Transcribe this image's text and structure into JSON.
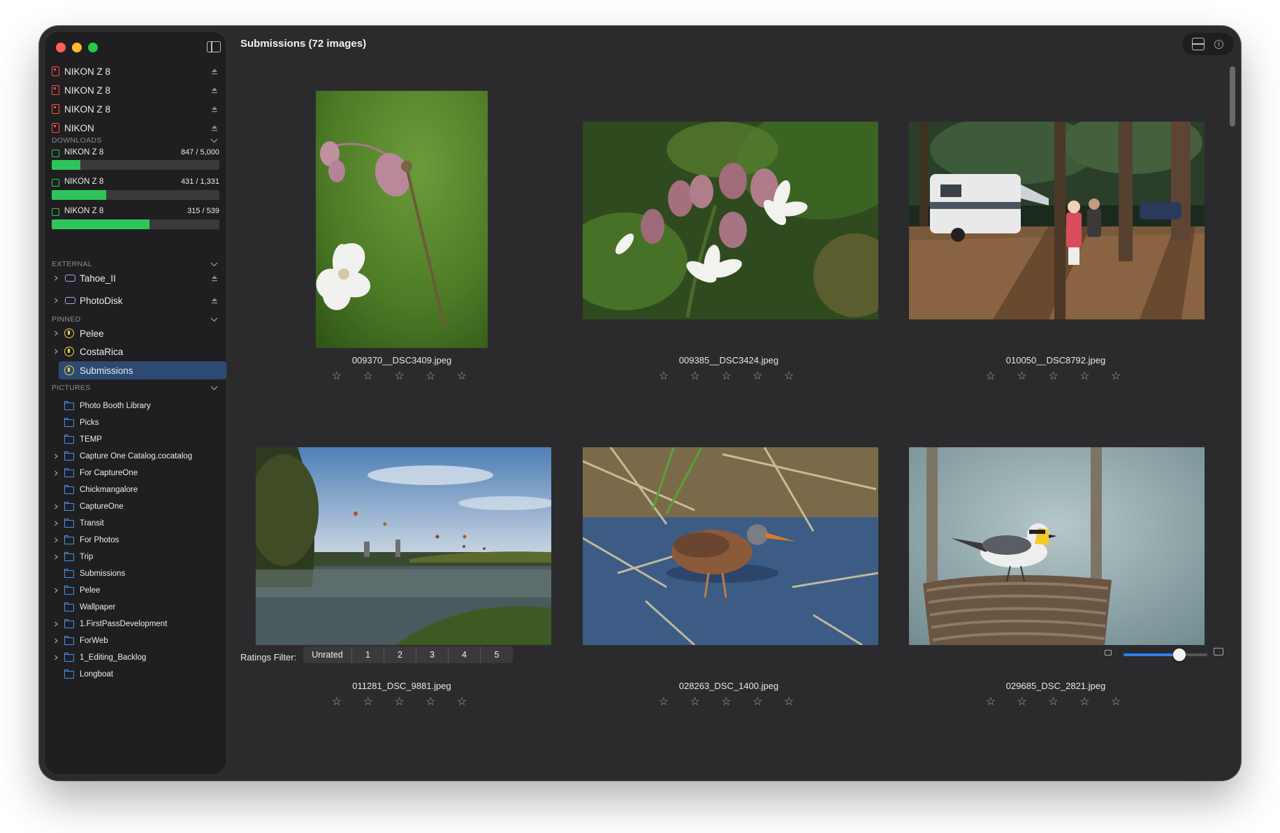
{
  "window": {
    "title": "Submissions (72 images)"
  },
  "sidebar": {
    "devices": [
      {
        "label": "NIKON Z 8",
        "icon": "camera-card-icon"
      },
      {
        "label": "NIKON Z 8",
        "icon": "camera-card-icon"
      },
      {
        "label": "NIKON Z 8",
        "icon": "camera-card-icon"
      },
      {
        "label": "NIKON",
        "icon": "camera-card-icon"
      }
    ],
    "downloads": {
      "header": "DOWNLOADS",
      "items": [
        {
          "label": "NIKON Z 8",
          "count": "847 / 5,000",
          "progress": 0.169
        },
        {
          "label": "NIKON Z 8",
          "count": "431 / 1,331",
          "progress": 0.324
        },
        {
          "label": "NIKON Z 8",
          "count": "315 / 539",
          "progress": 0.584
        }
      ]
    },
    "external": {
      "header": "EXTERNAL",
      "items": [
        {
          "label": "Tahoe_II"
        },
        {
          "label": "PhotoDisk"
        }
      ]
    },
    "pinned": {
      "header": "PINNED",
      "items": [
        {
          "label": "Pelee",
          "expandable": true
        },
        {
          "label": "CostaRica",
          "expandable": true
        },
        {
          "label": "Submissions",
          "expandable": false,
          "selected": true
        }
      ]
    },
    "pictures": {
      "header": "PICTURES",
      "items": [
        {
          "label": "Photo Booth Library",
          "expandable": false
        },
        {
          "label": "Picks",
          "expandable": false
        },
        {
          "label": "TEMP",
          "expandable": false
        },
        {
          "label": "Capture One Catalog.cocatalog",
          "expandable": true
        },
        {
          "label": "For CaptureOne",
          "expandable": true
        },
        {
          "label": "Chickmangalore",
          "expandable": false
        },
        {
          "label": "CaptureOne",
          "expandable": true
        },
        {
          "label": "Transit",
          "expandable": true
        },
        {
          "label": "For Photos",
          "expandable": true
        },
        {
          "label": "Trip",
          "expandable": true
        },
        {
          "label": "Submissions",
          "expandable": false
        },
        {
          "label": "Pelee",
          "expandable": true
        },
        {
          "label": "Wallpaper",
          "expandable": false
        },
        {
          "label": "1.FirstPassDevelopment",
          "expandable": true
        },
        {
          "label": "ForWeb",
          "expandable": true
        },
        {
          "label": "1_Editing_Backlog",
          "expandable": true
        },
        {
          "label": "Longboat",
          "expandable": false
        }
      ]
    }
  },
  "grid": {
    "images": [
      {
        "filename": "009370__DSC3409.jpeg",
        "rating": 0
      },
      {
        "filename": "009385__DSC3424.jpeg",
        "rating": 0
      },
      {
        "filename": "010050__DSC8792.jpeg",
        "rating": 0
      },
      {
        "filename": "011281_DSC_9881.jpeg",
        "rating": 0
      },
      {
        "filename": "028263_DSC_1400.jpeg",
        "rating": 0
      },
      {
        "filename": "029685_DSC_2821.jpeg",
        "rating": 0
      }
    ],
    "star_glyph": "☆ ☆ ☆ ☆ ☆"
  },
  "footer": {
    "ratings_filter_label": "Ratings Filter:",
    "ratings_options": [
      "Unrated",
      "1",
      "2",
      "3",
      "4",
      "5"
    ],
    "thumbnail_zoom": 0.67
  },
  "colors": {
    "accent": "#2f7ff0",
    "progress": "#2fc45a",
    "selection": "#2c4a72",
    "device_icon": "#ff4d4d",
    "folder_icon": "#4a90e2",
    "pinned_icon": "#e9d34a",
    "disk_icon": "#b89ae6"
  }
}
